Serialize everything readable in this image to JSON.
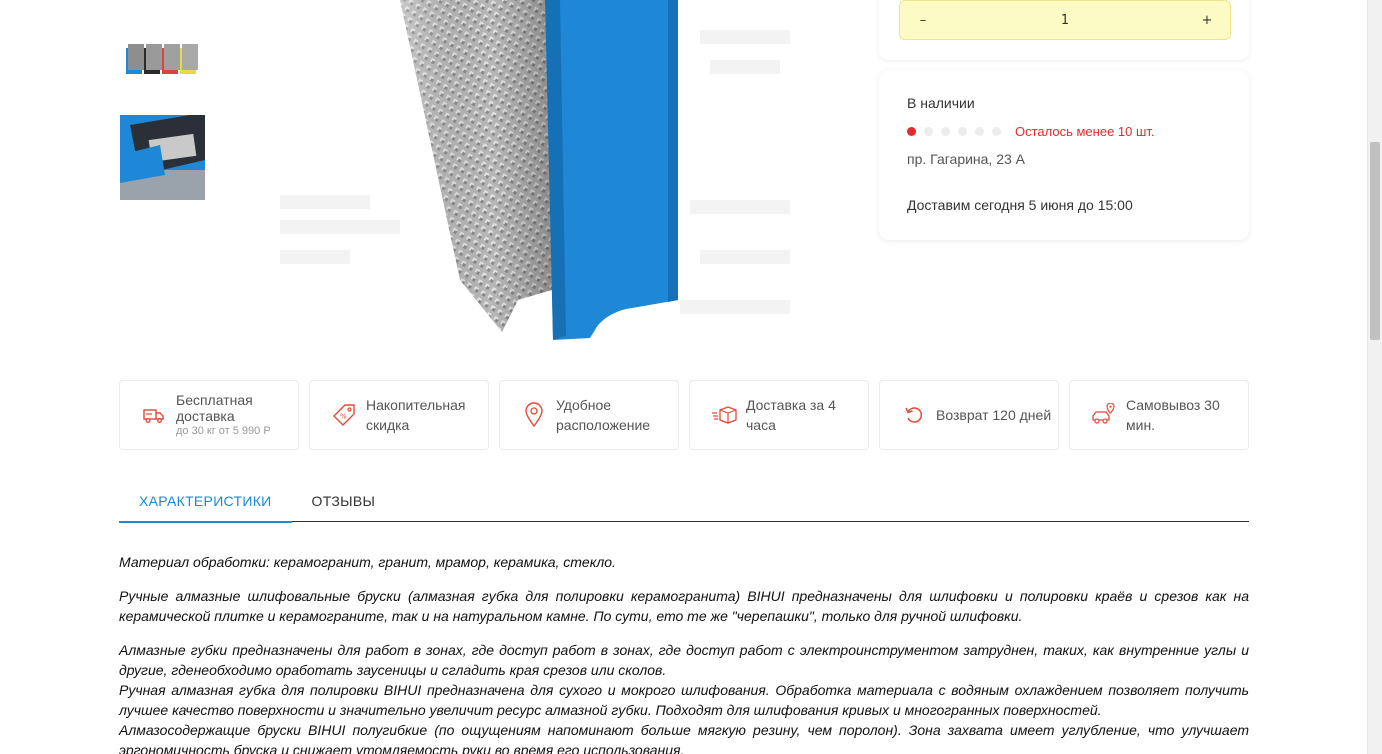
{
  "quantity": {
    "decrement": "–",
    "value": "1",
    "increment": "+"
  },
  "stock": {
    "title": "В наличии",
    "level_filled": 1,
    "level_total": 6,
    "low_stock": "Осталось менее 10 шт.",
    "address": "пр. Гагарина, 23 А",
    "delivery": "Доставим сегодня 5 июня до 15:00"
  },
  "features": [
    {
      "icon": "delivery-truck-icon",
      "label": "Бесплатная доставка",
      "sub": "до 30 кг от 5 990 Р"
    },
    {
      "icon": "discount-tag-icon",
      "label": "Накопительная скидка"
    },
    {
      "icon": "location-pin-icon",
      "label": "Удобное расположение"
    },
    {
      "icon": "fast-box-icon",
      "label": "Доставка за 4 часа"
    },
    {
      "icon": "return-arrow-icon",
      "label": "Возврат 120 дней"
    },
    {
      "icon": "pickup-car-icon",
      "label": "Самовывоз 30 мин."
    }
  ],
  "tabs": [
    {
      "label": "ХАРАКТЕРИСТИКИ",
      "active": true
    },
    {
      "label": "ОТЗЫВЫ",
      "active": false
    }
  ],
  "description": {
    "p1": "Материал обработки: керамогранит, гранит, мрамор, керамика, стекло.",
    "p2": "Ручные алмазные шлифовальные бруски (алмазная губка для полировки керамогранита) BIHUI предназначены для шлифовки и полировки краёв и срезов как на керамической плитке и керамограните, так и на натуральном камне. По сути, ето те же \"черепашки\", только для ручной шлифовки.",
    "p3": "Алмазные губки предназначены для работ в зонах, где доступ работ в зонах, где доступ работ с электроинструментом затруднен, таких, как внутренние углы и другие, гденеобходимо оработать заусеницы и сгладить края срезов или сколов.",
    "p4": "Ручная алмазная губка для полировки BIHUI предназначена для сухого и мокрого шлифования. Обработка материала с водяным охлаждением позволяет получить лучшее качество поверхности и значительно увеличит ресурс алмазной губки. Подходят для шлифования кривых и многогранных поверхностей.",
    "p5": "Алмазосодержащие бруски BIHUI полугибкие (по ощущениям напоминают больше мягкую резину, чем поролон). Зона захвата имеет углубление, что улучшает эргономичность бруска и снижает утомляемость руки во время его использования."
  },
  "colors": {
    "accent": "#1b8ad3",
    "stepper_bg": "#fdfbc4",
    "alert": "#e32b2b",
    "sponge_blue": "#1e88d6",
    "icon_red": "#e04b3a"
  }
}
